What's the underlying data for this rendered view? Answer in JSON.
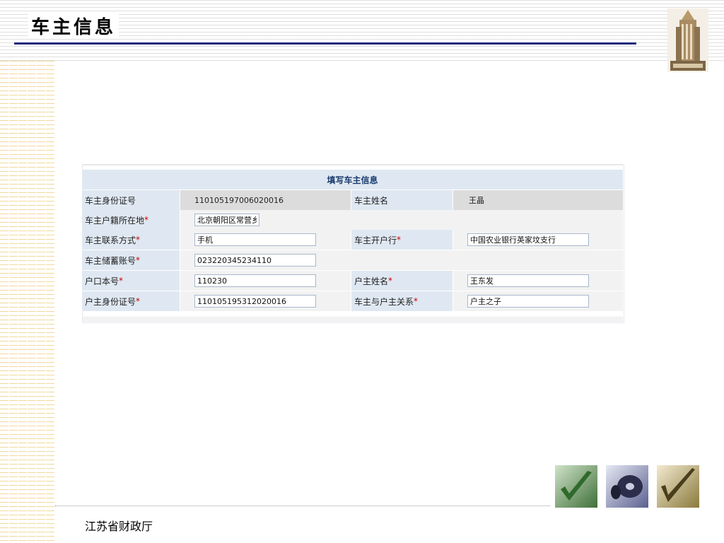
{
  "slide": {
    "title": "车主信息",
    "footer": "江苏省财政厅"
  },
  "form": {
    "heading": "填写车主信息",
    "required_mark": "*",
    "rows": [
      {
        "label": "车主身份证号",
        "value": "110105197006020016",
        "label2": "车主姓名",
        "value2": "王晶"
      },
      {
        "label": "车主户籍所在地",
        "value": "北京朝阳区常营乡"
      },
      {
        "label": "车主联系方式",
        "value": "手机",
        "label2": "车主开户行",
        "value2": "中国农业银行英家坟支行"
      },
      {
        "label": "车主储蓄账号",
        "value": "023220345234110"
      },
      {
        "label": "户口本号",
        "value": "110230",
        "label2": "户主姓名",
        "value2": "王东发"
      },
      {
        "label": "户主身份证号",
        "value": "110105195312020016",
        "label2": "车主与户主关系",
        "value2": "户主之子"
      }
    ]
  },
  "colors": {
    "title_rule": "#1f2a7a",
    "label_bg": "#dfe8f2",
    "heading_text": "#1a3c6e",
    "required": "#cc0000"
  },
  "decor": {
    "building_image": "building-photo",
    "thumbnails": [
      "green-checkmark-image",
      "blue-disc-image",
      "gold-checkmark-image"
    ]
  }
}
